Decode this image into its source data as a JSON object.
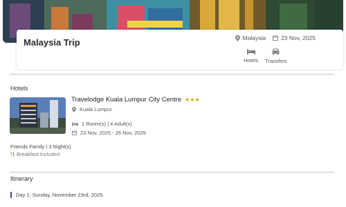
{
  "trip": {
    "title": "Malaysia Trip",
    "destination": "Malaysia",
    "date": "23 Nov, 2025",
    "services": [
      {
        "label": "Hotels",
        "icon": "bed-icon"
      },
      {
        "label": "Transfers",
        "icon": "car-icon"
      }
    ]
  },
  "hotels": {
    "section_title": "Hotels",
    "items": [
      {
        "name": "Travelodge Kuala Lumpur City Centre",
        "stars": 3,
        "stars_text": "★★★",
        "location": "Kuala Lumpur",
        "rooms": "1 Room(s) | 4 Adult(s)",
        "dates": "23 Nov, 2025 - 26 Nov, 2025",
        "room_type": "Friends Family | 3 Night(s)",
        "meal": "Breakfast Included"
      }
    ]
  },
  "itinerary": {
    "section_title": "Itinerary",
    "days": [
      {
        "label": "Day 1: Sunday, November 23rd, 2025"
      }
    ]
  },
  "colors": {
    "accent": "#3a4aa0",
    "star": "#e0a800",
    "divider": "#c9c9c9"
  }
}
